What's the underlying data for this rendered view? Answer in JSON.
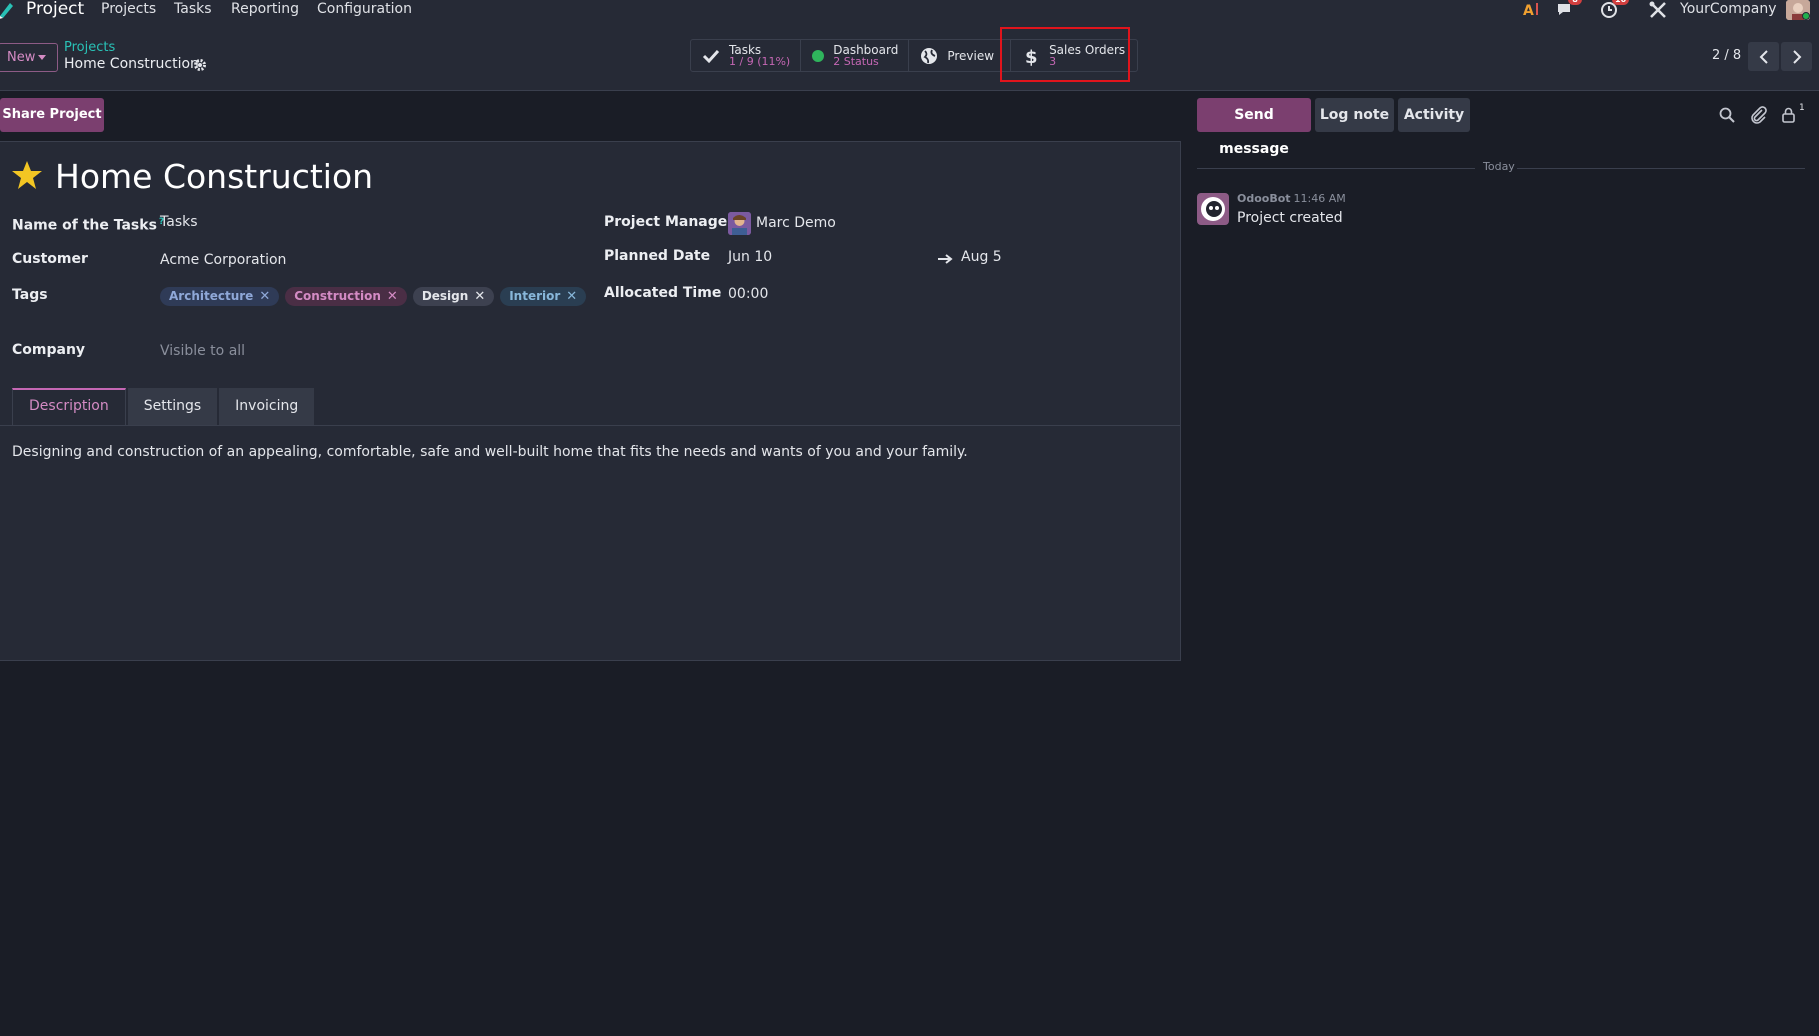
{
  "navbar": {
    "app_name": "Project",
    "menu": [
      "Projects",
      "Tasks",
      "Reporting",
      "Configuration"
    ],
    "messages_badge": "8",
    "activities_badge": "10",
    "company": "YourCompany"
  },
  "control_panel": {
    "new_label": "New",
    "breadcrumb_parent": "Projects",
    "breadcrumb_current": "Home Construction",
    "pager": "2 / 8"
  },
  "smart_buttons": {
    "tasks": {
      "title": "Tasks",
      "value": "1 / 9 (11%)"
    },
    "dashboard": {
      "title": "Dashboard",
      "value": "2 Status"
    },
    "preview": {
      "title": "Preview"
    },
    "sales_orders": {
      "title": "Sales Orders",
      "value": "3"
    }
  },
  "form": {
    "share_label": "Share Project",
    "title": "Home Construction",
    "fields": {
      "task_name_label": "Name of the Tasks",
      "task_name_help": "?",
      "task_name_value": "Tasks",
      "customer_label": "Customer",
      "customer_value": "Acme Corporation",
      "tags_label": "Tags",
      "company_label": "Company",
      "company_placeholder": "Visible to all",
      "manager_label": "Project Manager",
      "manager_value": "Marc Demo",
      "planned_label": "Planned Date",
      "planned_start": "Jun 10",
      "planned_end": "Aug 5",
      "allocated_label": "Allocated Time",
      "allocated_value": "00:00"
    },
    "tags": [
      "Architecture",
      "Construction",
      "Design",
      "Interior"
    ],
    "tag_remove": "✕",
    "tabs": [
      "Description",
      "Settings",
      "Invoicing"
    ],
    "description": "Designing and construction of an appealing, comfortable, safe and well-built home that fits the needs and wants of you and your family."
  },
  "chatter": {
    "send_message": "Send message",
    "log_note": "Log note",
    "activity": "Activity",
    "followers_count": "1",
    "date_separator": "Today",
    "message": {
      "author": "OdooBot",
      "time": "11:46 AM",
      "body": "Project created"
    }
  },
  "colors": {
    "accent": "#7b3f6f",
    "link": "#29c1b6",
    "highlight_box": "#e0141c"
  }
}
